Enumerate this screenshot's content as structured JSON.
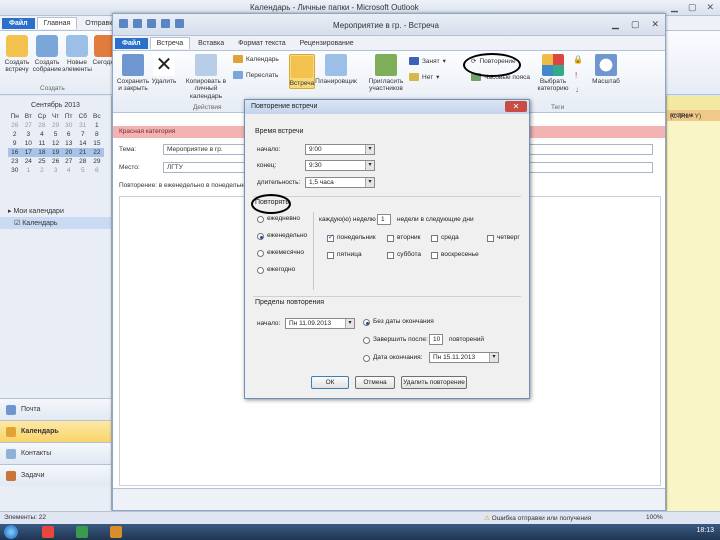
{
  "background_window": {
    "title": "Календарь - Личные папки - Microsoft Outlook",
    "tabs": [
      "Файл",
      "Главная",
      "Отправка и получение"
    ],
    "ribbon": [
      {
        "label": "Создать встречу"
      },
      {
        "label": "Создать собрание"
      },
      {
        "label": "Новые элементы"
      },
      {
        "label": "Сегодня"
      }
    ],
    "ribbon_group_label": "Создать",
    "mini_calendar": {
      "title": "Сентябрь 2013",
      "weekdays": [
        "Пн",
        "Вт",
        "Ср",
        "Чт",
        "Пт",
        "Сб",
        "Вс"
      ],
      "rows": [
        [
          "26",
          "27",
          "28",
          "29",
          "30",
          "31",
          "1"
        ],
        [
          "2",
          "3",
          "4",
          "5",
          "6",
          "7",
          "8"
        ],
        [
          "9",
          "10",
          "11",
          "12",
          "13",
          "14",
          "15"
        ],
        [
          "16",
          "17",
          "18",
          "19",
          "20",
          "21",
          "22"
        ],
        [
          "23",
          "24",
          "25",
          "26",
          "27",
          "28",
          "29"
        ],
        [
          "30",
          "1",
          "2",
          "3",
          "4",
          "5",
          "6"
        ]
      ]
    },
    "my_calendars_label": "Мои календари",
    "calendar_item": "Календарь",
    "nav_buttons": [
      "Почта",
      "Календарь",
      "Контакты",
      "Задачи"
    ],
    "right_panel": {
      "label": "(CTRL+ Y)",
      "tag": "вторник"
    },
    "status_bar": {
      "left": "Элементы: 22",
      "right": "Ошибка отправки или получения",
      "zoom": "100%"
    },
    "clock": "18:13"
  },
  "appointment_window": {
    "title": "Мероприятие в гр. - Встреча",
    "tabs": [
      "Файл",
      "Встреча",
      "Вставка",
      "Формат текста",
      "Рецензирование"
    ],
    "ribbon": {
      "save_close": "Сохранить и закрыть",
      "delete": "Удалить",
      "copy_to_calendar": "Копировать в личный календарь",
      "actions_group": "Действия",
      "calendar": "Календарь",
      "forward": "Переслать",
      "appointment": "Встреча",
      "scheduling": "Планировщик",
      "invite": "Пригласить участников",
      "show_as": "Занят",
      "reminder": "Нет",
      "recurrence": "Повторение",
      "time_zones": "Часовые пояса",
      "categorize": "Выбрать категорию",
      "tags_group": "Теги",
      "zoom": "Масштаб"
    },
    "info_bar": "Красная категория",
    "subject_label": "Тема:",
    "subject_value": "Мероприятие в гр.",
    "location_label": "Место:",
    "location_value": "ЛГТУ",
    "recurrence_note": "Повторение: в еженедельно в понедельник..."
  },
  "recurrence_dialog": {
    "title": "Повторение встречи",
    "time_section": "Время встречи",
    "start_label": "начало:",
    "start_value": "9:00",
    "end_label": "конец:",
    "end_value": "9:30",
    "duration_label": "длительность:",
    "duration_value": "1,5 часа",
    "pattern_section": "Повторять",
    "pattern_options": [
      "ежедневно",
      "еженедельно",
      "ежемесячно",
      "ежегодно"
    ],
    "every_label": "каждую(ю) неделю",
    "every_value": "1",
    "every_suffix": "недели в следующие дни",
    "days": [
      {
        "label": "понедельник",
        "checked": true
      },
      {
        "label": "вторник",
        "checked": false
      },
      {
        "label": "среда",
        "checked": false
      },
      {
        "label": "четверг",
        "checked": false
      },
      {
        "label": "пятница",
        "checked": false
      },
      {
        "label": "суббота",
        "checked": false
      },
      {
        "label": "воскресенье",
        "checked": false
      }
    ],
    "range_section": "Пределы повторения",
    "range_start_label": "начало:",
    "range_start_value": "Пн 11.09.2013",
    "no_end": "Без даты окончания",
    "end_after": "Завершить после:",
    "end_after_value": "10",
    "end_after_suffix": "повторений",
    "end_by": "Дата окончания:",
    "end_by_value": "Пн 15.11.2013",
    "ok": "ОК",
    "cancel": "Отмена",
    "remove": "Удалить повторение"
  }
}
